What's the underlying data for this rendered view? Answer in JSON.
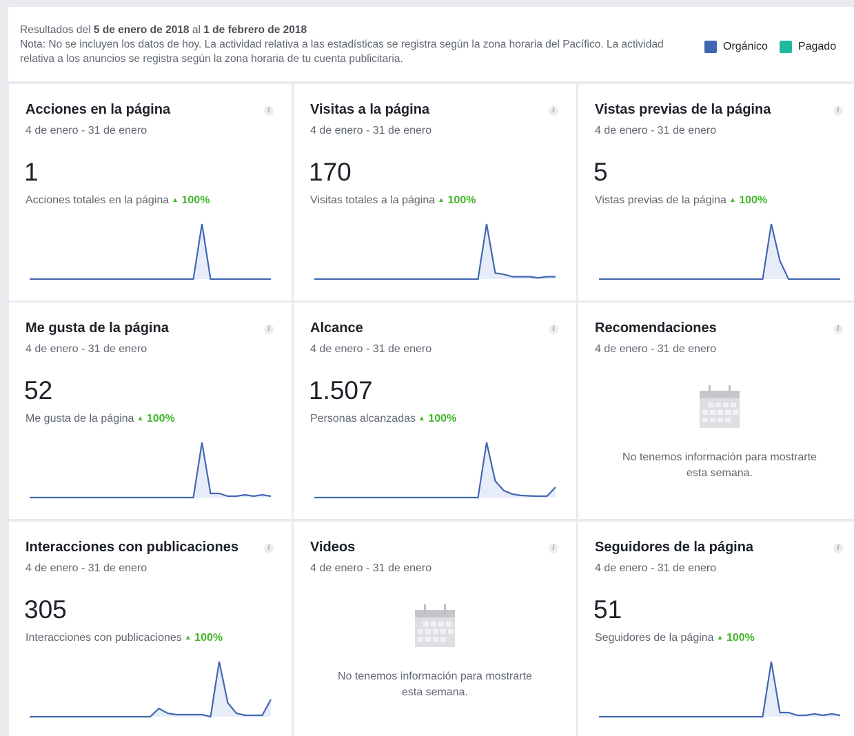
{
  "header": {
    "results_prefix": "Resultados del ",
    "start_date": "5 de enero de 2018",
    "results_mid": " al ",
    "end_date": "1 de febrero de 2018",
    "note": "Nota: No se incluyen los datos de hoy. La actividad relativa a las estadísticas se registra según la zona horaria del Pacífico. La actividad relativa a los anuncios se registra según la zona horaria de tu cuenta publicitaria."
  },
  "legend": [
    {
      "label": "Orgánico",
      "color": "#4267b2"
    },
    {
      "label": "Pagado",
      "color": "#23b9a1"
    }
  ],
  "colors": {
    "line": "#4267b2",
    "fill": "#e7edf8",
    "positive": "#42b72a"
  },
  "info_icon": "i",
  "cards": [
    {
      "title": "Acciones en la página",
      "date": "4 de enero - 31 de enero",
      "value": "1",
      "metric": "Acciones totales en la página",
      "change": "100%",
      "spark": [
        0,
        0,
        0,
        0,
        0,
        0,
        0,
        0,
        0,
        0,
        0,
        0,
        0,
        0,
        0,
        0,
        0,
        0,
        0,
        0,
        1,
        0,
        0,
        0,
        0,
        0,
        0,
        0,
        0
      ]
    },
    {
      "title": "Visitas a la página",
      "date": "4 de enero - 31 de enero",
      "value": "170",
      "metric": "Visitas totales a la página",
      "change": "100%",
      "spark": [
        0,
        0,
        0,
        0,
        0,
        0,
        0,
        0,
        0,
        0,
        0,
        0,
        0,
        0,
        0,
        0,
        0,
        0,
        0,
        0,
        46,
        5,
        4,
        2,
        2,
        2,
        1,
        2,
        2
      ]
    },
    {
      "title": "Vistas previas de la página",
      "date": "4 de enero - 31 de enero",
      "value": "5",
      "metric": "Vistas previas de la página",
      "change": "100%",
      "spark": [
        0,
        0,
        0,
        0,
        0,
        0,
        0,
        0,
        0,
        0,
        0,
        0,
        0,
        0,
        0,
        0,
        0,
        0,
        0,
        0,
        3,
        1,
        0,
        0,
        0,
        0,
        0,
        0,
        0
      ]
    },
    {
      "title": "Me gusta de la página",
      "date": "4 de enero - 31 de enero",
      "value": "52",
      "metric": "Me gusta de la página",
      "change": "100%",
      "spark": [
        0,
        0,
        0,
        0,
        0,
        0,
        0,
        0,
        0,
        0,
        0,
        0,
        0,
        0,
        0,
        0,
        0,
        0,
        0,
        0,
        40,
        3,
        3,
        1,
        1,
        2,
        1,
        2,
        1
      ]
    },
    {
      "title": "Alcance",
      "date": "4 de enero - 31 de enero",
      "value": "1.507",
      "metric": "Personas alcanzadas",
      "change": "100%",
      "spark": [
        0,
        0,
        0,
        0,
        0,
        0,
        0,
        0,
        0,
        0,
        0,
        0,
        0,
        0,
        0,
        0,
        0,
        0,
        0,
        0,
        400,
        120,
        50,
        25,
        15,
        12,
        10,
        10,
        75
      ]
    },
    {
      "title": "Recomendaciones",
      "date": "4 de enero - 31 de enero",
      "empty": "No tenemos información para mostrarte esta semana.",
      "calendar_icon": "calendar-icon"
    },
    {
      "title": "Interacciones con publicaciones",
      "date": "4 de enero - 31 de enero",
      "value": "305",
      "metric": "Interacciones con publicaciones",
      "change": "100%",
      "spark": [
        0,
        0,
        0,
        0,
        0,
        0,
        0,
        0,
        0,
        0,
        0,
        0,
        0,
        0,
        0,
        12,
        5,
        3,
        3,
        3,
        3,
        0,
        80,
        20,
        5,
        2,
        2,
        2,
        25
      ]
    },
    {
      "title": "Videos",
      "date": "4 de enero - 31 de enero",
      "empty": "No tenemos información para mostrarte esta semana.",
      "calendar_icon": "calendar-icon"
    },
    {
      "title": "Seguidores de la página",
      "date": "4 de enero - 31 de enero",
      "value": "51",
      "metric": "Seguidores de la página",
      "change": "100%",
      "spark": [
        0,
        0,
        0,
        0,
        0,
        0,
        0,
        0,
        0,
        0,
        0,
        0,
        0,
        0,
        0,
        0,
        0,
        0,
        0,
        0,
        40,
        3,
        3,
        1,
        1,
        2,
        1,
        2,
        1
      ]
    }
  ]
}
